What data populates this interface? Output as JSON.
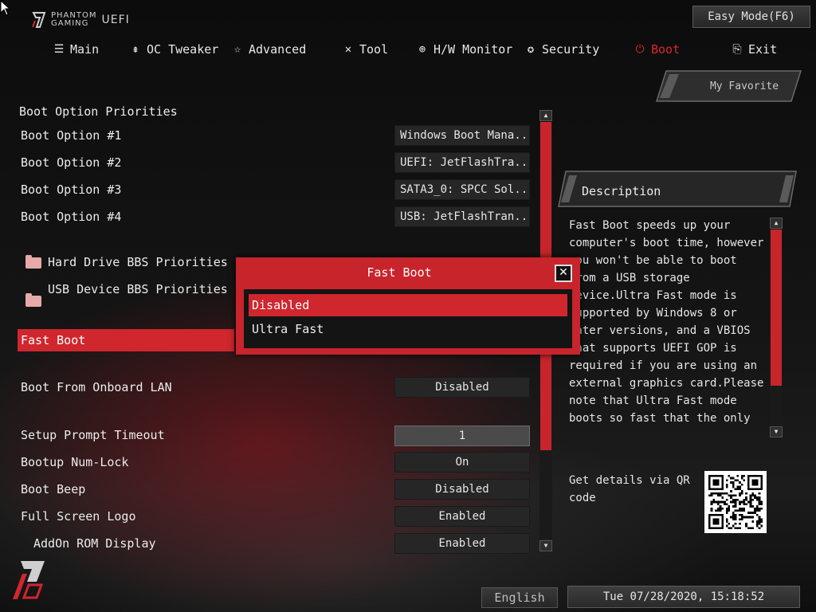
{
  "header": {
    "logo_line1": "PHANTOM",
    "logo_line2": "GAMING",
    "logo_uefi": "UEFI",
    "easy_mode": "Easy Mode(F6)"
  },
  "nav": {
    "items": [
      {
        "label": "Main",
        "icon": "list-icon"
      },
      {
        "label": "OC Tweaker",
        "icon": "rocket-icon"
      },
      {
        "label": "Advanced",
        "icon": "star-icon"
      },
      {
        "label": "Tool",
        "icon": "tools-icon"
      },
      {
        "label": "H/W Monitor",
        "icon": "monitor-icon"
      },
      {
        "label": "Security",
        "icon": "shield-icon"
      },
      {
        "label": "Boot",
        "icon": "power-icon"
      },
      {
        "label": "Exit",
        "icon": "exit-icon"
      }
    ],
    "active": "Boot"
  },
  "favorite": "My Favorite",
  "settings": {
    "section_title": "Boot Option Priorities",
    "boot_options": [
      {
        "label": "Boot Option #1",
        "value": "Windows Boot Mana..."
      },
      {
        "label": "Boot Option #2",
        "value": "UEFI: JetFlashTra..."
      },
      {
        "label": "Boot Option #3",
        "value": "SATA3_0: SPCC Sol..."
      },
      {
        "label": "Boot Option #4",
        "value": "USB: JetFlashTran..."
      }
    ],
    "hdd_bbs": "Hard Drive BBS Priorities",
    "usb_bbs": "USB Device BBS Priorities",
    "fast_boot": "Fast Boot",
    "onboard_lan": {
      "label": "Boot From Onboard LAN",
      "value": "Disabled"
    },
    "prompt_timeout": {
      "label": "Setup Prompt Timeout",
      "value": "1"
    },
    "numlock": {
      "label": "Bootup Num-Lock",
      "value": "On"
    },
    "beep": {
      "label": "Boot Beep",
      "value": "Disabled"
    },
    "full_logo": {
      "label": "Full Screen Logo",
      "value": "Enabled"
    },
    "addon_rom": {
      "label": "AddOn ROM Display",
      "value": "Enabled"
    }
  },
  "popup": {
    "title": "Fast Boot",
    "close": "✕",
    "options": [
      "Disabled",
      "Ultra Fast"
    ],
    "selected": "Disabled"
  },
  "description": {
    "title": "Description",
    "text": "Fast Boot speeds up your computer's boot time, however you won't be able to boot from a USB storage device.Ultra Fast mode is supported by Windows 8 or later versions, and a VBIOS that supports UEFI GOP is required if you are using an external graphics card.Please note that Ultra Fast mode boots so fast that the only way to enter this",
    "qr_label": "Get details via QR code"
  },
  "footer": {
    "language": "English",
    "datetime": "Tue 07/28/2020, 15:18:52"
  },
  "colors": {
    "accent": "#d0262e",
    "background": "#111111",
    "button": "#262626"
  }
}
